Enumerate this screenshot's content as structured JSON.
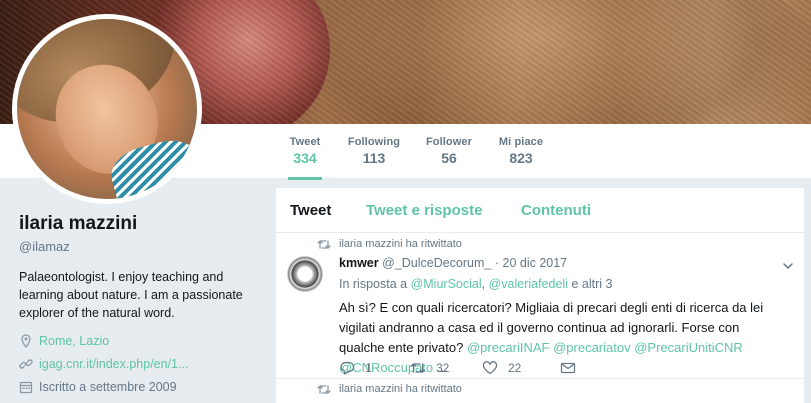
{
  "profile": {
    "name": "ilaria mazzini",
    "handle": "@ilamaz",
    "bio": "Palaeontologist. I enjoy teaching and learning about nature. I am a passionate explorer of the natural word.",
    "location": "Rome, Lazio",
    "website": "igag.cnr.it/index.php/en/1...",
    "joined": "Iscritto a settembre 2009"
  },
  "stats": [
    {
      "label": "Tweet",
      "value": "334"
    },
    {
      "label": "Following",
      "value": "113"
    },
    {
      "label": "Follower",
      "value": "56"
    },
    {
      "label": "Mi piace",
      "value": "823"
    }
  ],
  "tabs": [
    {
      "label": "Tweet"
    },
    {
      "label": "Tweet e risposte"
    },
    {
      "label": "Contenuti"
    }
  ],
  "tweet": {
    "context": "ilaria mazzini ha ritwittato",
    "author": "kmwer",
    "handle": "@_DulceDecorum_",
    "dot": "·",
    "date": "20 dic 2017",
    "reply_prefix": "In risposta a",
    "reply_user1": "@MiurSocial",
    "reply_sep": ",",
    "reply_user2": "@valeriafedeli",
    "reply_suffix": "e altri 3",
    "text": "Ah sì? E con quali ricercatori? Migliaia di precari degli enti di ricerca da lei vigilati andranno a casa ed il governo continua ad ignorarli. Forse con qualche ente privato?",
    "mentions": "@precariINAF @precariatov @PrecariUnitiCNR @CNRoccupato",
    "ellipsis": "...",
    "replies": "1",
    "retweets": "32",
    "likes": "22"
  },
  "tweet2": {
    "context": "ilaria mazzini ha ritwittato"
  },
  "colors": {
    "accent": "#5fc4a5",
    "background": "#e6ecf0",
    "muted": "#657786"
  }
}
